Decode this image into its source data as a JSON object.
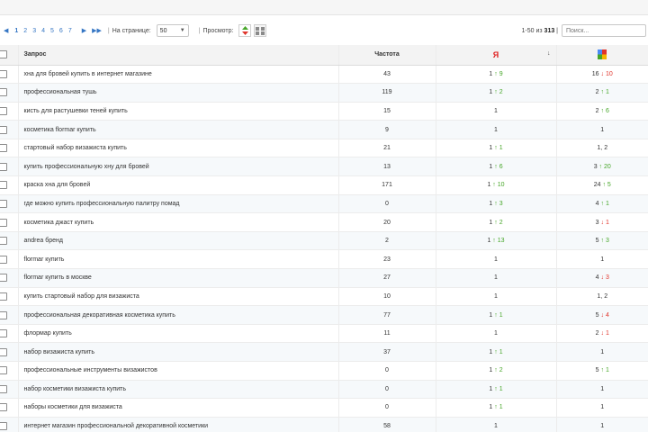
{
  "toolbar": {
    "pages": [
      "1",
      "2",
      "3",
      "4",
      "5",
      "6",
      "7"
    ],
    "per_page_label": "На странице:",
    "per_page_value": "50",
    "view_label": "Просмотр:",
    "sep": "|",
    "range": "1-50 из",
    "total": "313",
    "search_placeholder": "Поиск..."
  },
  "colors": {
    "up": "#46a628",
    "down": "#e0342b",
    "link": "#3576c4"
  },
  "table": {
    "headers": {
      "query": "Запрос",
      "freq": "Частота",
      "yandex": "Я",
      "sort": "↓"
    },
    "rows": [
      {
        "query": "хна для бровей купить в интернет магазине",
        "freq": "43",
        "y": {
          "a": "1",
          "dir": "up",
          "b": "9"
        },
        "g": {
          "a": "16",
          "dir": "down",
          "b": "10"
        }
      },
      {
        "query": "профессиональная тушь",
        "freq": "119",
        "y": {
          "a": "1",
          "dir": "up",
          "b": "2"
        },
        "g": {
          "a": "2",
          "dir": "up",
          "b": "1"
        }
      },
      {
        "query": "кисть для растушевки теней купить",
        "freq": "15",
        "y": {
          "a": "1"
        },
        "g": {
          "a": "2",
          "dir": "up",
          "b": "6"
        }
      },
      {
        "query": "косметика flormar купить",
        "freq": "9",
        "y": {
          "a": "1"
        },
        "g": {
          "a": "1"
        }
      },
      {
        "query": "стартовый набор визажиста купить",
        "freq": "21",
        "y": {
          "a": "1",
          "dir": "up",
          "b": "1"
        },
        "g": {
          "a": "1, 2"
        }
      },
      {
        "query": "купить профессиональную хну для бровей",
        "freq": "13",
        "y": {
          "a": "1",
          "dir": "up",
          "b": "6"
        },
        "g": {
          "a": "3",
          "dir": "up",
          "b": "20"
        }
      },
      {
        "query": "краска хна для бровей",
        "freq": "171",
        "y": {
          "a": "1",
          "dir": "up",
          "b": "10"
        },
        "g": {
          "a": "24",
          "dir": "up",
          "b": "5"
        }
      },
      {
        "query": "где можно купить профессиональную палитру помад",
        "freq": "0",
        "y": {
          "a": "1",
          "dir": "up",
          "b": "3"
        },
        "g": {
          "a": "4",
          "dir": "up",
          "b": "1"
        }
      },
      {
        "query": "косметика джаст купить",
        "freq": "20",
        "y": {
          "a": "1",
          "dir": "up",
          "b": "2"
        },
        "g": {
          "a": "3",
          "dir": "down",
          "b": "1"
        }
      },
      {
        "query": "andrea бренд",
        "freq": "2",
        "y": {
          "a": "1",
          "dir": "up",
          "b": "13"
        },
        "g": {
          "a": "5",
          "dir": "up",
          "b": "3"
        }
      },
      {
        "query": "flormar купить",
        "freq": "23",
        "y": {
          "a": "1"
        },
        "g": {
          "a": "1"
        }
      },
      {
        "query": "flormar купить в москве",
        "freq": "27",
        "y": {
          "a": "1"
        },
        "g": {
          "a": "4",
          "dir": "down",
          "b": "3"
        }
      },
      {
        "query": "купить стартовый набор для визажиста",
        "freq": "10",
        "y": {
          "a": "1"
        },
        "g": {
          "a": "1, 2"
        }
      },
      {
        "query": "профессиональная декоративная косметика купить",
        "freq": "77",
        "y": {
          "a": "1",
          "dir": "up",
          "b": "1"
        },
        "g": {
          "a": "5",
          "dir": "down",
          "b": "4"
        }
      },
      {
        "query": "флормар купить",
        "freq": "11",
        "y": {
          "a": "1"
        },
        "g": {
          "a": "2",
          "dir": "down",
          "b": "1"
        }
      },
      {
        "query": "набор визажиста купить",
        "freq": "37",
        "y": {
          "a": "1",
          "dir": "up",
          "b": "1"
        },
        "g": {
          "a": "1"
        }
      },
      {
        "query": "профессиональные инструменты визажистов",
        "freq": "0",
        "y": {
          "a": "1",
          "dir": "up",
          "b": "2"
        },
        "g": {
          "a": "5",
          "dir": "up",
          "b": "1"
        }
      },
      {
        "query": "набор косметики визажиста купить",
        "freq": "0",
        "y": {
          "a": "1",
          "dir": "up",
          "b": "1"
        },
        "g": {
          "a": "1"
        }
      },
      {
        "query": "наборы косметики для визажиста",
        "freq": "0",
        "y": {
          "a": "1",
          "dir": "up",
          "b": "1"
        },
        "g": {
          "a": "1"
        }
      },
      {
        "query": "интернет магазин профессиональной декоративной косметики",
        "freq": "58",
        "y": {
          "a": "1"
        },
        "g": {
          "a": "1"
        }
      }
    ]
  }
}
